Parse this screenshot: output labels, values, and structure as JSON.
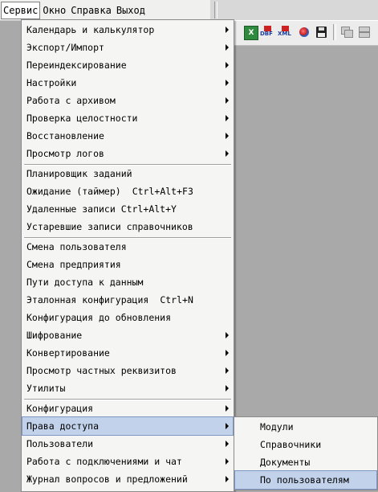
{
  "menubar": {
    "items": [
      "Сервис",
      "Окно",
      "Справка",
      "Выход"
    ]
  },
  "toolbar": {
    "icons": [
      "excel-icon",
      "dbf-export-icon",
      "xml-export-icon",
      "globe-icon",
      "floppy-icon",
      "cascade-windows-icon",
      "tile-windows-icon"
    ],
    "labels": {
      "dbf": "DBF",
      "xml": "XML"
    }
  },
  "service_menu": {
    "items": [
      {
        "label": "Календарь и калькулятор",
        "shortcut": "",
        "submenu": true
      },
      {
        "label": "Экспорт/Импорт",
        "shortcut": "",
        "submenu": true
      },
      {
        "label": "Переиндексирование",
        "shortcut": "",
        "submenu": true
      },
      {
        "label": "Настройки",
        "shortcut": "",
        "submenu": true
      },
      {
        "label": "Работа с архивом",
        "shortcut": "",
        "submenu": true
      },
      {
        "label": "Проверка целостности",
        "shortcut": "",
        "submenu": true
      },
      {
        "label": "Восстановление",
        "shortcut": "",
        "submenu": true
      },
      {
        "label": "Просмотр логов",
        "shortcut": "",
        "submenu": true
      },
      {
        "label": "Планировщик заданий",
        "shortcut": "",
        "submenu": false
      },
      {
        "label": "Ожидание (таймер)",
        "shortcut": "Ctrl+Alt+F3",
        "submenu": false
      },
      {
        "label": "Удаленные записи Ctrl+Alt+Y",
        "shortcut": "",
        "submenu": false
      },
      {
        "label": "Устаревшие записи справочников",
        "shortcut": "",
        "submenu": false
      },
      {
        "label": "Смена пользователя",
        "shortcut": "",
        "submenu": false
      },
      {
        "label": "Смена предприятия",
        "shortcut": "",
        "submenu": false
      },
      {
        "label": "Пути доступа к данным",
        "shortcut": "",
        "submenu": false
      },
      {
        "label": "Эталонная конфигурация",
        "shortcut": "Ctrl+N",
        "submenu": false
      },
      {
        "label": "Конфигурация до обновления",
        "shortcut": "",
        "submenu": false
      },
      {
        "label": "Шифрование",
        "shortcut": "",
        "submenu": true
      },
      {
        "label": "Конвертирование",
        "shortcut": "",
        "submenu": true
      },
      {
        "label": "Просмотр частных реквизитов",
        "shortcut": "",
        "submenu": true
      },
      {
        "label": "Утилиты",
        "shortcut": "",
        "submenu": true
      },
      {
        "label": "Конфигурация",
        "shortcut": "",
        "submenu": true
      },
      {
        "label": "Права доступа",
        "shortcut": "",
        "submenu": true
      },
      {
        "label": "Пользователи",
        "shortcut": "",
        "submenu": true
      },
      {
        "label": "Работа с подключениями и чат",
        "shortcut": "",
        "submenu": true
      },
      {
        "label": "Журнал вопросов и предложений",
        "shortcut": "",
        "submenu": true
      }
    ],
    "highlighted_index": 22
  },
  "access_rights_submenu": {
    "items": [
      "Модули",
      "Справочники",
      "Документы",
      "По пользователям"
    ],
    "highlighted_index": 3
  },
  "colors": {
    "highlight": "#c2d2eb",
    "menu_bg": "#f5f5f3",
    "workspace": "#a9a9a9"
  }
}
